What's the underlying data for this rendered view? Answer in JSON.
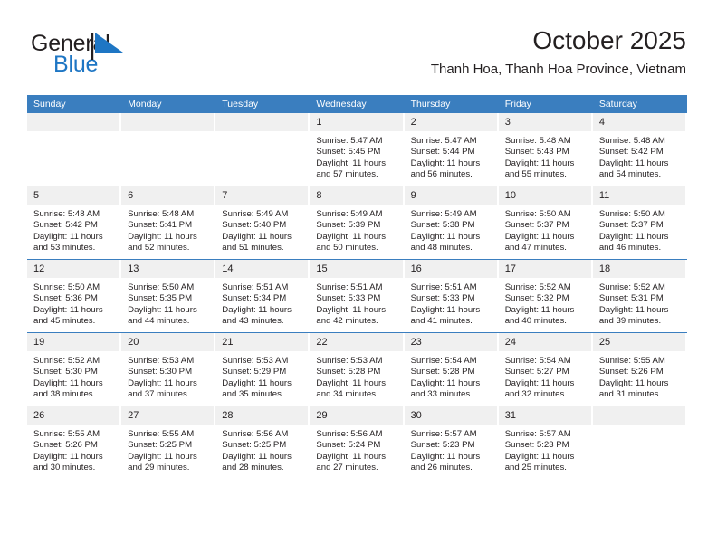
{
  "brand": {
    "name_part1": "General",
    "name_part2": "Blue",
    "logo_icon": "triangle-flag-icon",
    "accent_color": "#1e76c4"
  },
  "header": {
    "month_title": "October 2025",
    "location": "Thanh Hoa, Thanh Hoa Province, Vietnam"
  },
  "calendar": {
    "header_bg_color": "#3a7ebf",
    "daynum_bg_color": "#f0f0f0",
    "weekday_headers": [
      "Sunday",
      "Monday",
      "Tuesday",
      "Wednesday",
      "Thursday",
      "Friday",
      "Saturday"
    ],
    "weeks": [
      [
        {
          "day": "",
          "sunrise": "",
          "sunset": "",
          "daylight_line1": "",
          "daylight_line2": ""
        },
        {
          "day": "",
          "sunrise": "",
          "sunset": "",
          "daylight_line1": "",
          "daylight_line2": ""
        },
        {
          "day": "",
          "sunrise": "",
          "sunset": "",
          "daylight_line1": "",
          "daylight_line2": ""
        },
        {
          "day": "1",
          "sunrise": "Sunrise: 5:47 AM",
          "sunset": "Sunset: 5:45 PM",
          "daylight_line1": "Daylight: 11 hours",
          "daylight_line2": "and 57 minutes."
        },
        {
          "day": "2",
          "sunrise": "Sunrise: 5:47 AM",
          "sunset": "Sunset: 5:44 PM",
          "daylight_line1": "Daylight: 11 hours",
          "daylight_line2": "and 56 minutes."
        },
        {
          "day": "3",
          "sunrise": "Sunrise: 5:48 AM",
          "sunset": "Sunset: 5:43 PM",
          "daylight_line1": "Daylight: 11 hours",
          "daylight_line2": "and 55 minutes."
        },
        {
          "day": "4",
          "sunrise": "Sunrise: 5:48 AM",
          "sunset": "Sunset: 5:42 PM",
          "daylight_line1": "Daylight: 11 hours",
          "daylight_line2": "and 54 minutes."
        }
      ],
      [
        {
          "day": "5",
          "sunrise": "Sunrise: 5:48 AM",
          "sunset": "Sunset: 5:42 PM",
          "daylight_line1": "Daylight: 11 hours",
          "daylight_line2": "and 53 minutes."
        },
        {
          "day": "6",
          "sunrise": "Sunrise: 5:48 AM",
          "sunset": "Sunset: 5:41 PM",
          "daylight_line1": "Daylight: 11 hours",
          "daylight_line2": "and 52 minutes."
        },
        {
          "day": "7",
          "sunrise": "Sunrise: 5:49 AM",
          "sunset": "Sunset: 5:40 PM",
          "daylight_line1": "Daylight: 11 hours",
          "daylight_line2": "and 51 minutes."
        },
        {
          "day": "8",
          "sunrise": "Sunrise: 5:49 AM",
          "sunset": "Sunset: 5:39 PM",
          "daylight_line1": "Daylight: 11 hours",
          "daylight_line2": "and 50 minutes."
        },
        {
          "day": "9",
          "sunrise": "Sunrise: 5:49 AM",
          "sunset": "Sunset: 5:38 PM",
          "daylight_line1": "Daylight: 11 hours",
          "daylight_line2": "and 48 minutes."
        },
        {
          "day": "10",
          "sunrise": "Sunrise: 5:50 AM",
          "sunset": "Sunset: 5:37 PM",
          "daylight_line1": "Daylight: 11 hours",
          "daylight_line2": "and 47 minutes."
        },
        {
          "day": "11",
          "sunrise": "Sunrise: 5:50 AM",
          "sunset": "Sunset: 5:37 PM",
          "daylight_line1": "Daylight: 11 hours",
          "daylight_line2": "and 46 minutes."
        }
      ],
      [
        {
          "day": "12",
          "sunrise": "Sunrise: 5:50 AM",
          "sunset": "Sunset: 5:36 PM",
          "daylight_line1": "Daylight: 11 hours",
          "daylight_line2": "and 45 minutes."
        },
        {
          "day": "13",
          "sunrise": "Sunrise: 5:50 AM",
          "sunset": "Sunset: 5:35 PM",
          "daylight_line1": "Daylight: 11 hours",
          "daylight_line2": "and 44 minutes."
        },
        {
          "day": "14",
          "sunrise": "Sunrise: 5:51 AM",
          "sunset": "Sunset: 5:34 PM",
          "daylight_line1": "Daylight: 11 hours",
          "daylight_line2": "and 43 minutes."
        },
        {
          "day": "15",
          "sunrise": "Sunrise: 5:51 AM",
          "sunset": "Sunset: 5:33 PM",
          "daylight_line1": "Daylight: 11 hours",
          "daylight_line2": "and 42 minutes."
        },
        {
          "day": "16",
          "sunrise": "Sunrise: 5:51 AM",
          "sunset": "Sunset: 5:33 PM",
          "daylight_line1": "Daylight: 11 hours",
          "daylight_line2": "and 41 minutes."
        },
        {
          "day": "17",
          "sunrise": "Sunrise: 5:52 AM",
          "sunset": "Sunset: 5:32 PM",
          "daylight_line1": "Daylight: 11 hours",
          "daylight_line2": "and 40 minutes."
        },
        {
          "day": "18",
          "sunrise": "Sunrise: 5:52 AM",
          "sunset": "Sunset: 5:31 PM",
          "daylight_line1": "Daylight: 11 hours",
          "daylight_line2": "and 39 minutes."
        }
      ],
      [
        {
          "day": "19",
          "sunrise": "Sunrise: 5:52 AM",
          "sunset": "Sunset: 5:30 PM",
          "daylight_line1": "Daylight: 11 hours",
          "daylight_line2": "and 38 minutes."
        },
        {
          "day": "20",
          "sunrise": "Sunrise: 5:53 AM",
          "sunset": "Sunset: 5:30 PM",
          "daylight_line1": "Daylight: 11 hours",
          "daylight_line2": "and 37 minutes."
        },
        {
          "day": "21",
          "sunrise": "Sunrise: 5:53 AM",
          "sunset": "Sunset: 5:29 PM",
          "daylight_line1": "Daylight: 11 hours",
          "daylight_line2": "and 35 minutes."
        },
        {
          "day": "22",
          "sunrise": "Sunrise: 5:53 AM",
          "sunset": "Sunset: 5:28 PM",
          "daylight_line1": "Daylight: 11 hours",
          "daylight_line2": "and 34 minutes."
        },
        {
          "day": "23",
          "sunrise": "Sunrise: 5:54 AM",
          "sunset": "Sunset: 5:28 PM",
          "daylight_line1": "Daylight: 11 hours",
          "daylight_line2": "and 33 minutes."
        },
        {
          "day": "24",
          "sunrise": "Sunrise: 5:54 AM",
          "sunset": "Sunset: 5:27 PM",
          "daylight_line1": "Daylight: 11 hours",
          "daylight_line2": "and 32 minutes."
        },
        {
          "day": "25",
          "sunrise": "Sunrise: 5:55 AM",
          "sunset": "Sunset: 5:26 PM",
          "daylight_line1": "Daylight: 11 hours",
          "daylight_line2": "and 31 minutes."
        }
      ],
      [
        {
          "day": "26",
          "sunrise": "Sunrise: 5:55 AM",
          "sunset": "Sunset: 5:26 PM",
          "daylight_line1": "Daylight: 11 hours",
          "daylight_line2": "and 30 minutes."
        },
        {
          "day": "27",
          "sunrise": "Sunrise: 5:55 AM",
          "sunset": "Sunset: 5:25 PM",
          "daylight_line1": "Daylight: 11 hours",
          "daylight_line2": "and 29 minutes."
        },
        {
          "day": "28",
          "sunrise": "Sunrise: 5:56 AM",
          "sunset": "Sunset: 5:25 PM",
          "daylight_line1": "Daylight: 11 hours",
          "daylight_line2": "and 28 minutes."
        },
        {
          "day": "29",
          "sunrise": "Sunrise: 5:56 AM",
          "sunset": "Sunset: 5:24 PM",
          "daylight_line1": "Daylight: 11 hours",
          "daylight_line2": "and 27 minutes."
        },
        {
          "day": "30",
          "sunrise": "Sunrise: 5:57 AM",
          "sunset": "Sunset: 5:23 PM",
          "daylight_line1": "Daylight: 11 hours",
          "daylight_line2": "and 26 minutes."
        },
        {
          "day": "31",
          "sunrise": "Sunrise: 5:57 AM",
          "sunset": "Sunset: 5:23 PM",
          "daylight_line1": "Daylight: 11 hours",
          "daylight_line2": "and 25 minutes."
        },
        {
          "day": "",
          "sunrise": "",
          "sunset": "",
          "daylight_line1": "",
          "daylight_line2": ""
        }
      ]
    ]
  }
}
